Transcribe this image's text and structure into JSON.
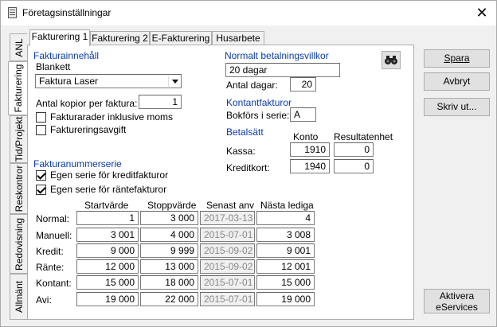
{
  "window": {
    "title": "Företagsinställningar"
  },
  "side_tabs": [
    "ANL",
    "Fakturering",
    "Tid/Projekt",
    "Reskontror",
    "Redovisning",
    "Allmänt"
  ],
  "top_tabs": [
    "Fakturering 1",
    "Fakturering 2",
    "E-Fakturering",
    "Husarbete"
  ],
  "faktura": {
    "heading": "Fakturainnehåll",
    "blankett_label": "Blankett",
    "blankett_value": "Faktura Laser",
    "kopior_label": "Antal kopior per faktura:",
    "kopior_value": "1",
    "cb1_label": "Fakturarader inklusive moms",
    "cb2_label": "Faktureringsavgift"
  },
  "villkor": {
    "heading": "Normalt betalningsvillkor",
    "value": "20 dagar",
    "dagar_label": "Antal dagar:",
    "dagar_value": "20"
  },
  "kontant": {
    "heading": "Kontantfakturor",
    "bokfors_label": "Bokförs i serie:",
    "bokfors_value": "A"
  },
  "betalsatt": {
    "heading": "Betalsätt",
    "col_konto": "Konto",
    "col_result": "Resultatenhet",
    "rows": [
      {
        "label": "Kassa:",
        "konto": "1910",
        "res": "0"
      },
      {
        "label": "Kreditkort:",
        "konto": "1940",
        "res": "0"
      }
    ]
  },
  "serie": {
    "heading": "Fakturanummerserie",
    "cb1_label": "Egen serie för kreditfakturor",
    "cb2_label": "Egen serie för räntefakturor",
    "col_start": "Startvärde",
    "col_stopp": "Stoppvärde",
    "col_senast": "Senast anv",
    "col_nasta": "Nästa lediga",
    "rows": [
      {
        "label": "Normal:",
        "start": "1",
        "stopp": "3 000",
        "senast": "2017-03-13",
        "nasta": "4"
      },
      {
        "label": "Manuell:",
        "start": "3 001",
        "stopp": "4 000",
        "senast": "2015-07-01",
        "nasta": "3 008"
      },
      {
        "label": "Kredit:",
        "start": "9 000",
        "stopp": "9 999",
        "senast": "2015-09-02",
        "nasta": "9 001"
      },
      {
        "label": "Ränte:",
        "start": "12 000",
        "stopp": "13 000",
        "senast": "2015-09-02",
        "nasta": "12 001"
      },
      {
        "label": "Kontant:",
        "start": "15 000",
        "stopp": "18 000",
        "senast": "2015-07-01",
        "nasta": "15 000"
      },
      {
        "label": "Avi:",
        "start": "19 000",
        "stopp": "22 000",
        "senast": "2015-07-01",
        "nasta": "19 000"
      }
    ]
  },
  "buttons": {
    "spara": "Spara",
    "avbryt": "Avbryt",
    "skriv": "Skriv ut...",
    "aktivera_1": "Aktivera",
    "aktivera_2": "eServices"
  }
}
